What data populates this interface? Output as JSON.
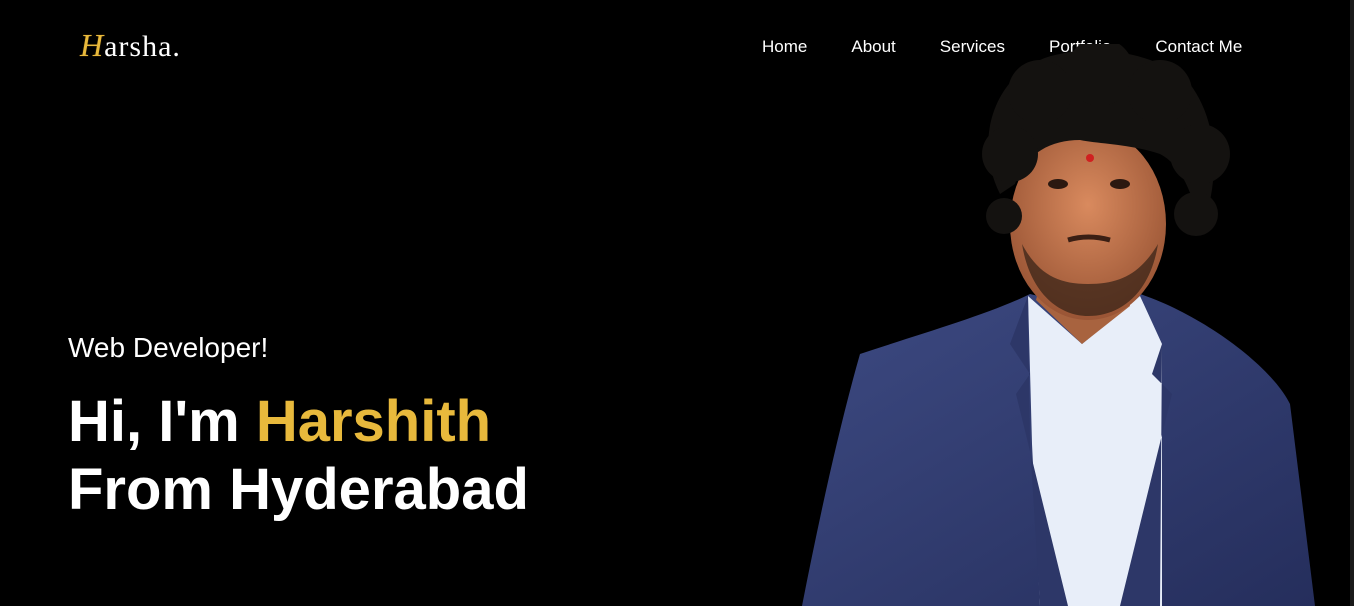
{
  "brand": {
    "logo_initial": "H",
    "logo_rest": "arsha.",
    "accent_color": "#e8b93c"
  },
  "nav": {
    "items": [
      "Home",
      "About",
      "Services",
      "Portfolio",
      "Contact Me"
    ]
  },
  "hero": {
    "subtitle": "Web Developer!",
    "greeting": "Hi, I'm ",
    "name": "Harshith",
    "line2": "From Hyderabad"
  },
  "photo": {
    "icon": "person-portrait"
  }
}
